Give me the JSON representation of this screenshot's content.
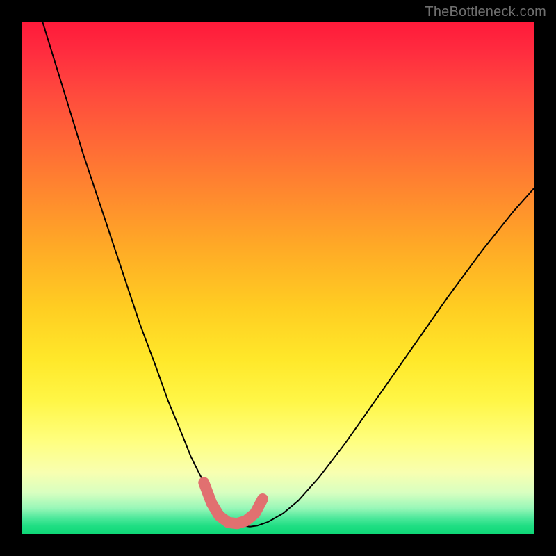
{
  "watermark": {
    "text": "TheBottleneck.com"
  },
  "chart_data": {
    "type": "line",
    "title": "",
    "xlabel": "",
    "ylabel": "",
    "xlim": [
      0,
      1
    ],
    "ylim": [
      0,
      1
    ],
    "grid": false,
    "legend": false,
    "series": [
      {
        "name": "bottleneck-curve",
        "color": "#000000",
        "stroke_width": 2,
        "x": [
          0.04,
          0.08,
          0.12,
          0.16,
          0.2,
          0.23,
          0.26,
          0.285,
          0.31,
          0.33,
          0.35,
          0.37,
          0.385,
          0.4,
          0.415,
          0.43,
          0.445,
          0.46,
          0.48,
          0.51,
          0.54,
          0.58,
          0.63,
          0.69,
          0.76,
          0.83,
          0.9,
          0.96,
          1.0
        ],
        "y": [
          1.0,
          0.87,
          0.74,
          0.62,
          0.5,
          0.41,
          0.33,
          0.26,
          0.2,
          0.15,
          0.11,
          0.075,
          0.05,
          0.033,
          0.022,
          0.016,
          0.014,
          0.016,
          0.023,
          0.04,
          0.065,
          0.11,
          0.175,
          0.26,
          0.36,
          0.46,
          0.555,
          0.63,
          0.675
        ]
      },
      {
        "name": "valley-highlight",
        "color": "#e17070",
        "stroke_width": 16,
        "x": [
          0.355,
          0.37,
          0.385,
          0.403,
          0.42,
          0.437,
          0.455,
          0.47
        ],
        "y": [
          0.1,
          0.06,
          0.035,
          0.022,
          0.02,
          0.025,
          0.04,
          0.068
        ]
      }
    ],
    "background": {
      "type": "vertical-gradient",
      "stops": [
        {
          "pos": 0.0,
          "color": "#ff1a3a"
        },
        {
          "pos": 0.24,
          "color": "#ff6a36"
        },
        {
          "pos": 0.56,
          "color": "#ffce22"
        },
        {
          "pos": 0.82,
          "color": "#ffff80"
        },
        {
          "pos": 0.95,
          "color": "#98f7b8"
        },
        {
          "pos": 1.0,
          "color": "#0fd777"
        }
      ]
    }
  }
}
